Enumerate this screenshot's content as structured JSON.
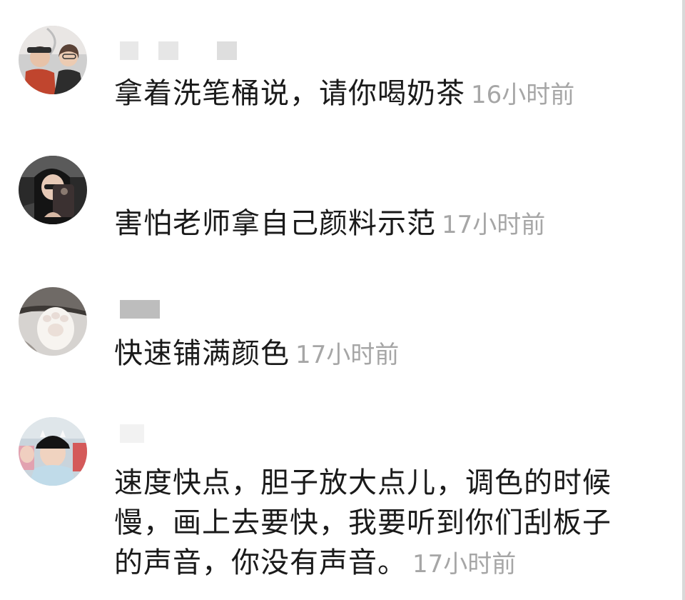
{
  "comments": [
    {
      "avatar": "avatar-two-girls-icon",
      "text": "拿着洗笔桶说，请你喝奶茶",
      "time": "16小时前"
    },
    {
      "avatar": "avatar-girl-phone-selfie-icon",
      "text": "害怕老师拿自己颜料示范",
      "time": "17小时前"
    },
    {
      "avatar": "avatar-cat-paw-icon",
      "text": "快速铺满颜色",
      "time": "17小时前"
    },
    {
      "avatar": "avatar-girls-cap-icon",
      "text": "速度快点，胆子放大点儿，调色的时候慢，画上去要快，我要听到你们刮板子的声音，你没有声音。",
      "time": "17小时前"
    }
  ],
  "colors": {
    "text": "#1a1a1a",
    "time": "#a6a6a6",
    "blur": "#e3e3e3",
    "background": "#ffffff"
  }
}
